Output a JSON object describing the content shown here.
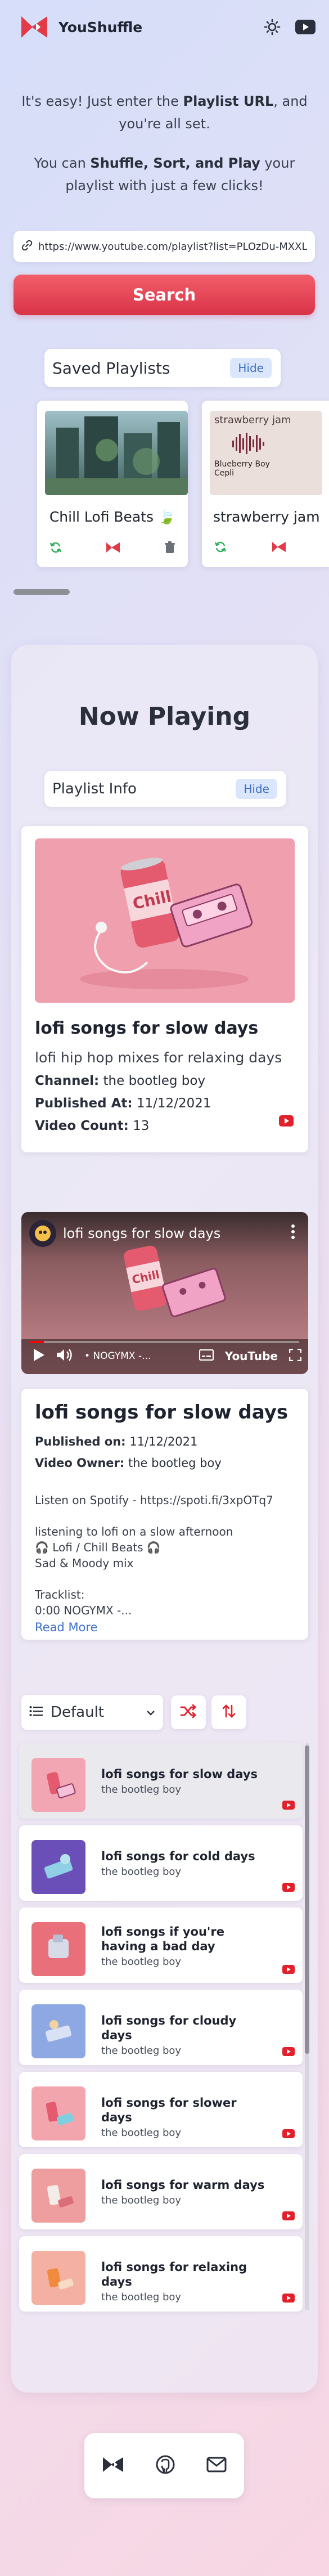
{
  "app": {
    "brand": "YouShuffle"
  },
  "intro": {
    "line1_pre": "It's easy! Just enter the ",
    "line1_bold": "Playlist URL",
    "line1_post": ", and you're all set.",
    "line2_pre": "You can ",
    "line2_bold": "Shuffle, Sort, and Play",
    "line2_post": " your playlist with just a few clicks!"
  },
  "search": {
    "url_value": "https://www.youtube.com/playlist?list=PLOzDu-MXXL",
    "button_label": "Search"
  },
  "saved": {
    "heading": "Saved Playlists",
    "hide_label": "Hide",
    "cards": [
      {
        "title": "Chill Lofi Beats 🍃",
        "thumb_color": "#4f7a77"
      },
      {
        "title": "strawberry jam",
        "thumb_heading": "strawberry jam",
        "thumb_caption1": "Blueberry Boy",
        "thumb_caption2": "Cepli",
        "thumb_color": "#e8dcd8"
      }
    ]
  },
  "now_playing": {
    "heading": "Now Playing",
    "info_heading": "Playlist Info",
    "hide_label": "Hide",
    "playlist": {
      "title": "lofi songs for slow days",
      "description": "lofi hip hop mixes for relaxing days",
      "channel_label": "Channel:",
      "channel": "the bootleg boy",
      "published_label": "Published At:",
      "published": "11/12/2021",
      "count_label": "Video Count:",
      "count": "13"
    },
    "video": {
      "title": "lofi songs for slow days",
      "channel_tag": "• NOGYMX -...",
      "youtube_label": "YouTube",
      "progress": 0.05
    },
    "video_details": {
      "title": "lofi songs for slow days",
      "published_label": "Published on:",
      "published": "11/12/2021",
      "owner_label": "Video Owner:",
      "owner": "the bootleg boy",
      "body": "Listen on Spotify - https://spoti.fi/3xpOTq7\n\nlistening to lofi on a slow afternoon\n🎧 Lofi / Chill Beats 🎧\nSad & Moody mix\n\nTracklist:\n0:00 NOGYMX -...",
      "read_more": "Read More"
    },
    "sort": {
      "selected": "Default"
    },
    "items": [
      {
        "title": "lofi songs for slow days",
        "owner": "the bootleg boy",
        "thumb": "#f2a6b3",
        "active": true
      },
      {
        "title": "lofi songs for cold days",
        "owner": "the bootleg boy",
        "thumb": "#6a4fb8"
      },
      {
        "title": "lofi songs if you're having a bad day",
        "owner": "the bootleg boy",
        "thumb": "#e9707b"
      },
      {
        "title": "lofi songs for cloudy days",
        "owner": "the bootleg boy",
        "thumb": "#8ea8e3"
      },
      {
        "title": "lofi songs for slower days",
        "owner": "the bootleg boy",
        "thumb": "#f3a5ae"
      },
      {
        "title": "lofi songs for warm days",
        "owner": "the bootleg boy",
        "thumb": "#ee9e9e"
      },
      {
        "title": "lofi songs for relaxing days",
        "owner": "the bootleg boy",
        "thumb": "#f4b0a2"
      }
    ]
  },
  "colors": {
    "accent_red": "#e03a4c",
    "link_blue": "#3e6fc9",
    "green_icon": "#2fae5a"
  }
}
